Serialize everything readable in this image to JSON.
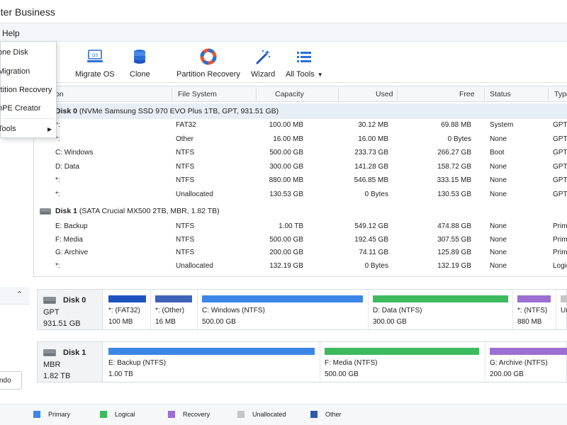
{
  "window": {
    "title": "aster Business"
  },
  "menubar": {
    "help": "Help"
  },
  "dropdown": {
    "items": [
      {
        "label": "one Disk"
      },
      {
        "label": " Migration"
      },
      {
        "label": "rtition Recovery"
      },
      {
        "label": "nPE Creator"
      },
      {
        "label": " Tools"
      }
    ]
  },
  "toolbar": {
    "migrate": "Migrate OS",
    "clone": "Clone",
    "recovery": "Partition Recovery",
    "wizard": "Wizard",
    "alltools": "All Tools",
    "os_badge": "OS"
  },
  "table": {
    "headers": [
      "on",
      "File System",
      "Capacity",
      "Used",
      "Free",
      "Status",
      "Type"
    ],
    "disk0": {
      "name": "Disk 0",
      "desc": "(NVMe Samsung SSD 970 EVO Plus 1TB, GPT, 931.51 GB)"
    },
    "disk0_rows": [
      [
        "*:",
        "FAT32",
        "100.00 MB",
        "30.12 MB",
        "69.88 MB",
        "System",
        "GPT"
      ],
      [
        "*:",
        "Other",
        "16.00 MB",
        "16.00 MB",
        "0 Bytes",
        "None",
        "GPT"
      ],
      [
        "C: Windows",
        "NTFS",
        "500.00 GB",
        "233.73 GB",
        "266.27 GB",
        "Boot",
        "GPT"
      ],
      [
        "D: Data",
        "NTFS",
        "300.00 GB",
        "141.28 GB",
        "158.72 GB",
        "None",
        "GPT"
      ],
      [
        "*:",
        "NTFS",
        "880.00 MB",
        "546.85 MB",
        "333.15 MB",
        "None",
        "GPT"
      ],
      [
        "*:",
        "Unallocated",
        "130.53 GB",
        "0 Bytes",
        "130.53 GB",
        "None",
        "GPT"
      ]
    ],
    "disk1": {
      "name": "Disk 1",
      "desc": "(SATA Crucial MX500 2TB, MBR, 1.82 TB)"
    },
    "disk1_rows": [
      [
        "E: Backup",
        "NTFS",
        "1.00 TB",
        "549.12 GB",
        "474.88 GB",
        "None",
        "Prima"
      ],
      [
        "F: Media",
        "NTFS",
        "500.00 GB",
        "192.45 GB",
        "307.55 GB",
        "None",
        "Prima"
      ],
      [
        "G: Archive",
        "NTFS",
        "200.00 GB",
        "74.11 GB",
        "125.89 GB",
        "None",
        "Prima"
      ],
      [
        "*:",
        "Unallocated",
        "132.19 GB",
        "0 Bytes",
        "132.19 GB",
        "None",
        "Logic"
      ]
    ]
  },
  "leftpanel": {
    "undo": "ndo"
  },
  "diskmap": {
    "disk0": {
      "name": "Disk 0",
      "style": "GPT",
      "size": "931.51 GB",
      "segs": [
        {
          "label": "*: (FAT32)",
          "size": "100 MB",
          "color": "#1f55c0"
        },
        {
          "label": "*: (Other)",
          "size": "16 MB",
          "color": "#3e64b8"
        },
        {
          "label": "C: Windows (NTFS)",
          "size": "500.00 GB",
          "color": "#3b86e6"
        },
        {
          "label": "D: Data (NTFS)",
          "size": "300.00 GB",
          "color": "#3dba5e"
        },
        {
          "label": "*: (NTFS)",
          "size": "880 MB",
          "color": "#9c6fd2"
        },
        {
          "label": "Un",
          "size": "",
          "color": "#c6c6c6"
        }
      ]
    },
    "disk1": {
      "name": "Disk 1",
      "style": "MBR",
      "size": "1.82 TB",
      "segs": [
        {
          "label": "E: Backup (NTFS)",
          "size": "1.00 TB",
          "color": "#3b86e6"
        },
        {
          "label": "F: Media (NTFS)",
          "size": "500.00 GB",
          "color": "#3dba5e"
        },
        {
          "label": "G: Archive (NTFS)",
          "size": "200.00 GB",
          "color": "#9c6fd2"
        }
      ]
    }
  },
  "legend": [
    {
      "label": "Primary",
      "color": "#3b86e6"
    },
    {
      "label": "Logical",
      "color": "#3dba5e"
    },
    {
      "label": "Recovery",
      "color": "#9c6fd2"
    },
    {
      "label": "Unallocated",
      "color": "#c6c6c6"
    },
    {
      "label": "Other",
      "color": "#2f5aa8"
    }
  ]
}
